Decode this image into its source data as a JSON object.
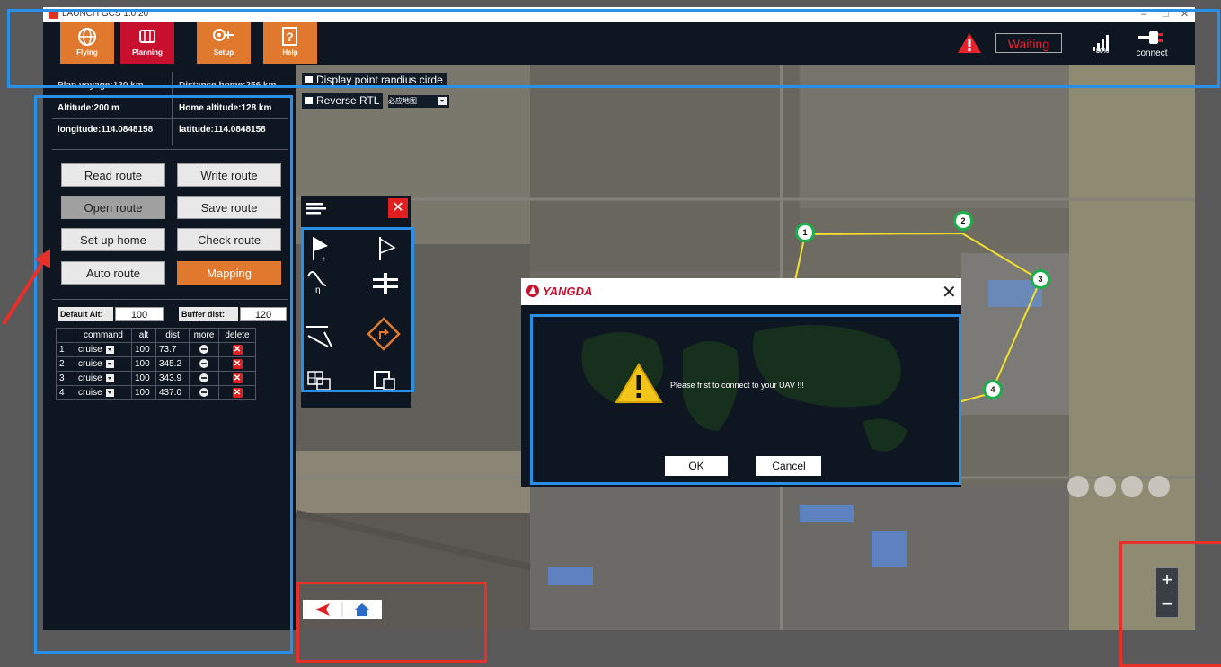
{
  "window": {
    "title": "LAUNCH GCS 1.0.20",
    "controls": [
      "–",
      "□",
      "✕"
    ]
  },
  "toolbar": {
    "tabs": [
      {
        "label": "Flying",
        "icon": "globe-icon"
      },
      {
        "label": "Planning",
        "icon": "route-icon"
      },
      {
        "label": "Setup",
        "icon": "drone-setup-icon"
      },
      {
        "label": "Help",
        "icon": "help-icon"
      }
    ],
    "active_tab": "Planning",
    "status": "Waiting",
    "signal_pct": "80%",
    "connect_label": "connect",
    "status_color": "#e8232d"
  },
  "info": {
    "plan_voyage": "Plan voyage:120 km",
    "distance_home": "Distance home:256 km",
    "altitude": "Altitude:200 m",
    "home_altitude": "Home altitude:128 km",
    "longitude": "longitude:114.0848158",
    "latitude": "latitude:114.0848158"
  },
  "route_buttons": {
    "read": "Read route",
    "write": "Write route",
    "open": "Open route",
    "save": "Save route",
    "setup_home": "Set up home",
    "check": "Check route",
    "auto": "Auto route",
    "mapping": "Mapping"
  },
  "params": {
    "default_alt_label": "Default Alt:",
    "default_alt_value": "100",
    "buffer_dist_label": "Buffer dist:",
    "buffer_dist_value": "120"
  },
  "waypoint_table": {
    "headers": [
      "",
      "command",
      "alt",
      "dist",
      "more",
      "delete"
    ],
    "rows": [
      {
        "n": "1",
        "command": "cruise",
        "alt": "100",
        "dist": "73.7"
      },
      {
        "n": "2",
        "command": "cruise",
        "alt": "100",
        "dist": "345.2"
      },
      {
        "n": "3",
        "command": "cruise",
        "alt": "100",
        "dist": "343.9"
      },
      {
        "n": "4",
        "command": "cruise",
        "alt": "100",
        "dist": "437.0"
      }
    ]
  },
  "map": {
    "display_radius": "Display point randius cirde",
    "reverse_rtl": "Reverse RTL",
    "rtl_option": "必应地图",
    "waypoint_labels": [
      "1",
      "2",
      "3",
      "4"
    ]
  },
  "dialog": {
    "brand": "YANGDA",
    "message": "Please frist to connect to your UAV !!!",
    "ok": "OK",
    "cancel": "Cancel"
  },
  "zoom": {
    "in": "+",
    "out": "−"
  }
}
